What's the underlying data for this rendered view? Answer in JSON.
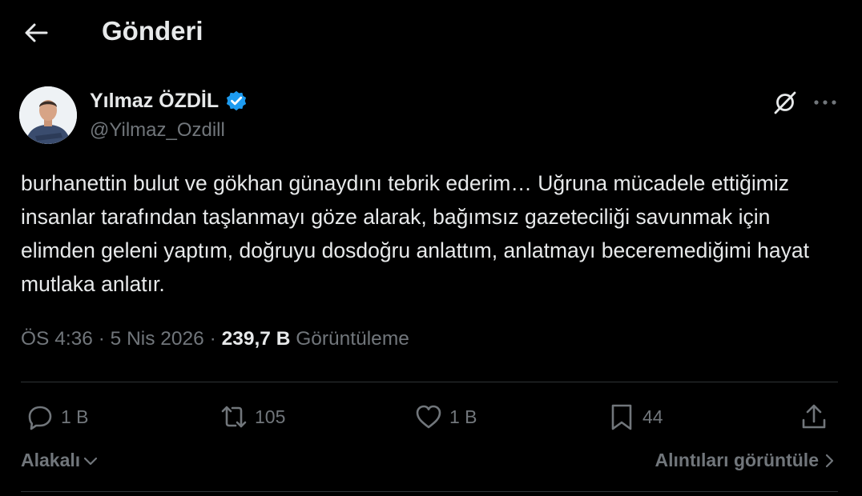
{
  "header": {
    "title": "Gönderi",
    "back_icon": "arrow-left-icon"
  },
  "author": {
    "name": "Yılmaz ÖZDİL",
    "handle": "@Yilmaz_Ozdill",
    "verified": true,
    "verified_color": "#1d9bf0"
  },
  "tweet": {
    "text": "burhanettin bulut ve gökhan günaydını tebrik ederim… Uğruna mücadele ettiğimiz insanlar tarafından taşlanmayı göze alarak, bağımsız gazeteciliği savunmak için elimden geleni yaptım, doğruyu dosdoğru anlattım, anlatmayı beceremediğimi hayat mutlaka anlatır.",
    "time": "ÖS 4:36",
    "date": "5 Nis 2026",
    "views": "239,7 B",
    "views_label": "Görüntüleme"
  },
  "actions": {
    "replies": "1 B",
    "reposts": "105",
    "likes": "1 B",
    "bookmarks": "44"
  },
  "footer": {
    "sort_label": "Alakalı",
    "quotes_label": "Alıntıları görüntüle"
  },
  "colors": {
    "background": "#000000",
    "text": "#e7e9ea",
    "muted": "#71767b",
    "accent": "#1d9bf0",
    "divider": "#2f3336"
  }
}
